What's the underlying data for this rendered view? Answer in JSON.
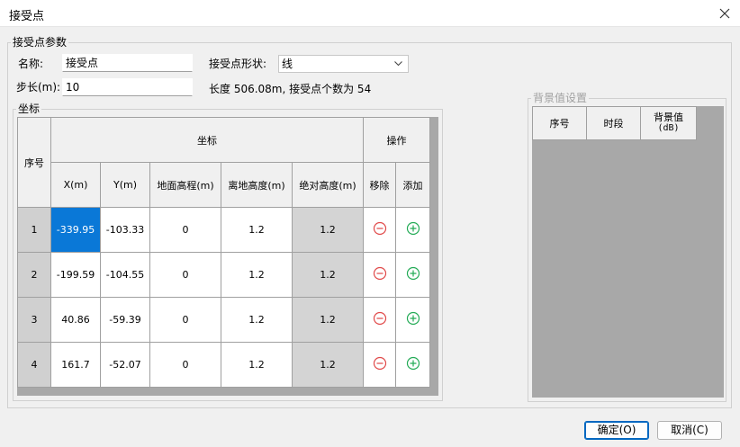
{
  "window": {
    "title": "接受点"
  },
  "params": {
    "group_label": "接受点参数",
    "name_label": "名称:",
    "name_value": "接受点",
    "shape_label": "接受点形状:",
    "shape_value": "线",
    "step_label": "步长(m):",
    "step_value": "10",
    "info_text": "长度 506.08m, 接受点个数为 54"
  },
  "coords": {
    "group_label": "坐标",
    "headers": {
      "index": "序号",
      "coord_group": "坐标",
      "op_group": "操作",
      "x": "X(m)",
      "y": "Y(m)",
      "ground": "地面高程(m)",
      "height": "离地高度(m)",
      "absolute": "绝对高度(m)",
      "remove": "移除",
      "add": "添加"
    },
    "rows": [
      {
        "index": "1",
        "x": "-339.95",
        "y": "-103.33",
        "ground": "0",
        "height": "1.2",
        "absolute": "1.2"
      },
      {
        "index": "2",
        "x": "-199.59",
        "y": "-104.55",
        "ground": "0",
        "height": "1.2",
        "absolute": "1.2"
      },
      {
        "index": "3",
        "x": "40.86",
        "y": "-59.39",
        "ground": "0",
        "height": "1.2",
        "absolute": "1.2"
      },
      {
        "index": "4",
        "x": "161.7",
        "y": "-52.07",
        "ground": "0",
        "height": "1.2",
        "absolute": "1.2"
      }
    ]
  },
  "background": {
    "group_label": "背景值设置",
    "headers": {
      "index": "序号",
      "period": "时段",
      "value": "背景值",
      "unit": "(dB)"
    }
  },
  "buttons": {
    "ok": "确定(O)",
    "cancel": "取消(C)"
  },
  "icons": {
    "remove": "minus-circle-icon",
    "add": "plus-circle-icon",
    "close": "close-icon",
    "dropdown": "chevron-down-icon"
  },
  "colors": {
    "remove": "#e04848",
    "add": "#22aa55",
    "selection": "#0a78d7",
    "accent": "#0067c0"
  }
}
